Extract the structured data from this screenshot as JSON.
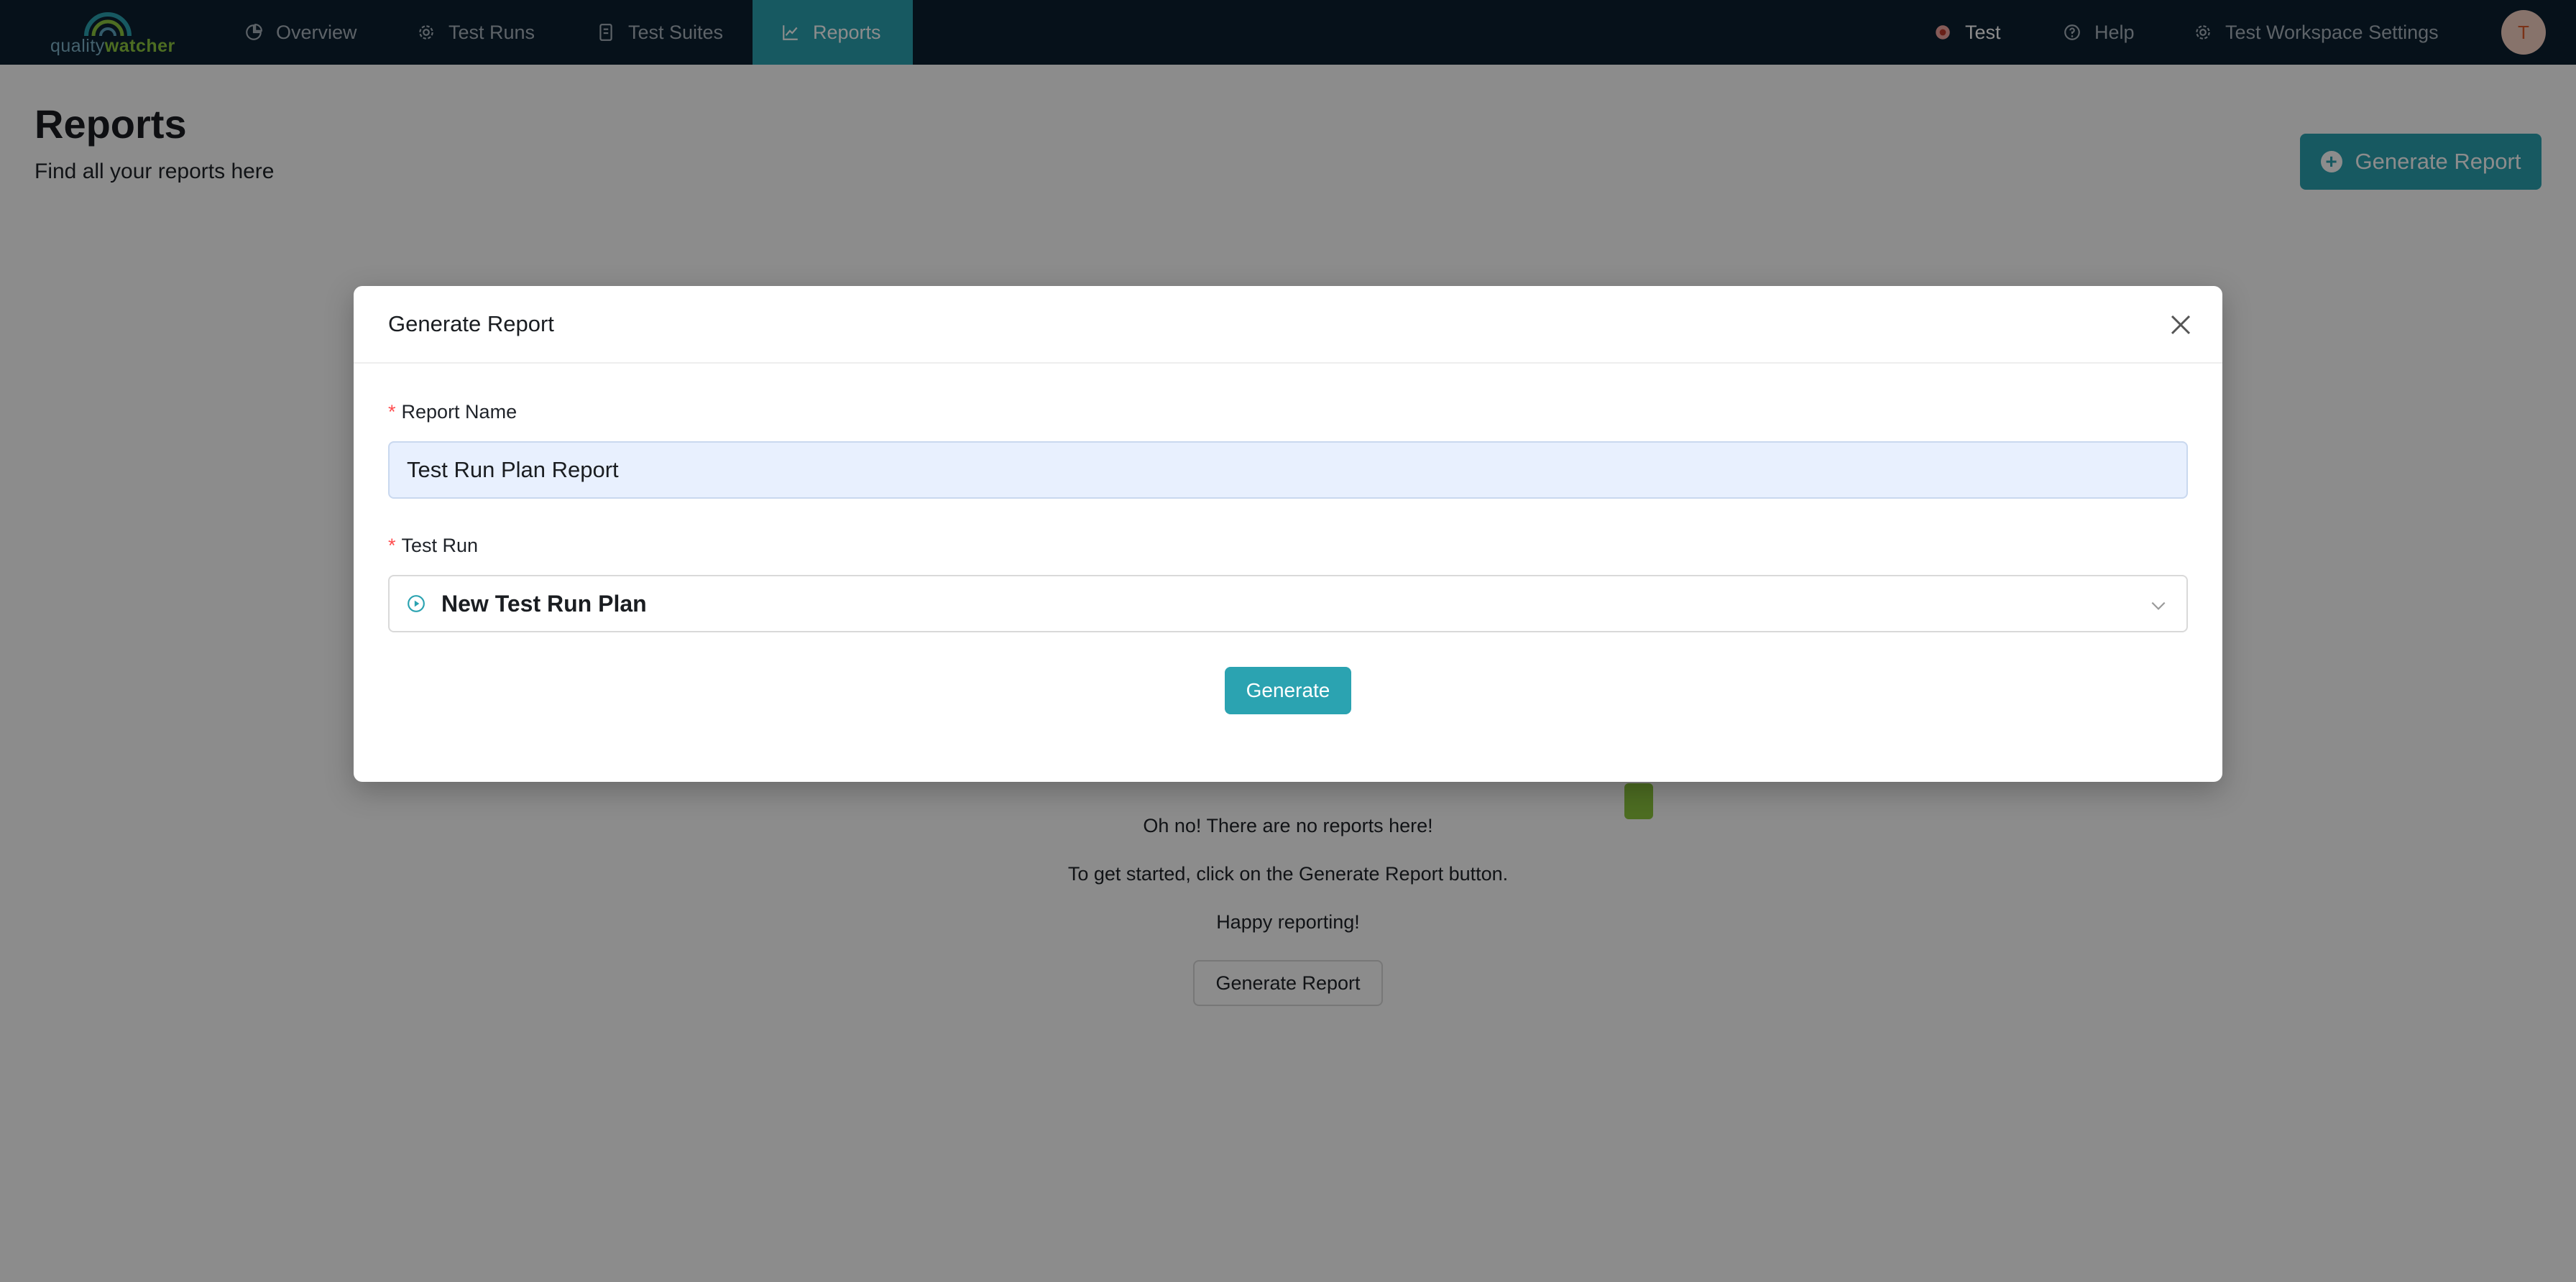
{
  "brand": {
    "logo_part1": "quality",
    "logo_part2": "watcher"
  },
  "nav": {
    "items": [
      {
        "label": "Overview",
        "icon": "pie-chart-icon"
      },
      {
        "label": "Test Runs",
        "icon": "gear-icon"
      },
      {
        "label": "Test Suites",
        "icon": "document-icon"
      },
      {
        "label": "Reports",
        "icon": "line-chart-icon",
        "active": true
      }
    ],
    "right": [
      {
        "label": "Test",
        "icon": "workspace-icon"
      },
      {
        "label": "Help",
        "icon": "help-circle-icon"
      },
      {
        "label": "Test Workspace Settings",
        "icon": "gear-icon"
      }
    ],
    "avatar_initial": "T"
  },
  "page": {
    "title": "Reports",
    "subtitle": "Find all your reports here",
    "generate_button_label": "Generate Report"
  },
  "empty_state": {
    "line1": "Oh no! There are no reports here!",
    "line2": "To get started, click on the Generate Report button.",
    "line3": "Happy reporting!",
    "button_label": "Generate Report"
  },
  "modal": {
    "title": "Generate Report",
    "report_name_label": "Report Name",
    "report_name_value": "Test Run Plan Report",
    "test_run_label": "Test Run",
    "test_run_value": "New Test Run Plan",
    "required_mark": "*",
    "generate_label": "Generate"
  },
  "colors": {
    "nav_bg": "#0c1f30",
    "accent": "#2ba3b1",
    "required": "#ff4d4f",
    "input_filled_bg": "#e8f0fe"
  }
}
